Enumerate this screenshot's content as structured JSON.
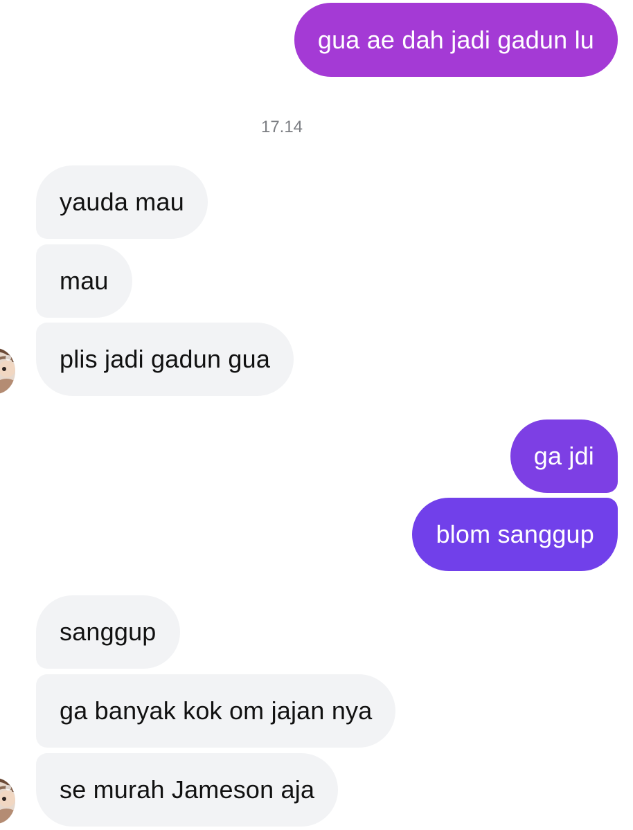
{
  "conversation": {
    "messages": [
      {
        "sender": "me",
        "text": "gua ae dah jadi gadun lu"
      },
      {
        "sender": "them",
        "text": "yauda mau"
      },
      {
        "sender": "them",
        "text": "mau"
      },
      {
        "sender": "them",
        "text": "plis jadi gadun gua"
      },
      {
        "sender": "me",
        "text": "ga jdi"
      },
      {
        "sender": "me",
        "text": "blom sanggup"
      },
      {
        "sender": "them",
        "text": "sanggup"
      },
      {
        "sender": "them",
        "text": "ga banyak kok om jajan nya"
      },
      {
        "sender": "them",
        "text": "se murah Jameson aja"
      }
    ],
    "timestamp": "17.14"
  },
  "colors": {
    "outgoing_gradient_top": "#a33ad6",
    "outgoing_gradient_bottom": "#7140ea",
    "incoming_bubble": "#f2f3f5",
    "incoming_text": "#111111",
    "timestamp_text": "#7b7d82"
  },
  "icons": {
    "contact_avatar": "avatar"
  }
}
